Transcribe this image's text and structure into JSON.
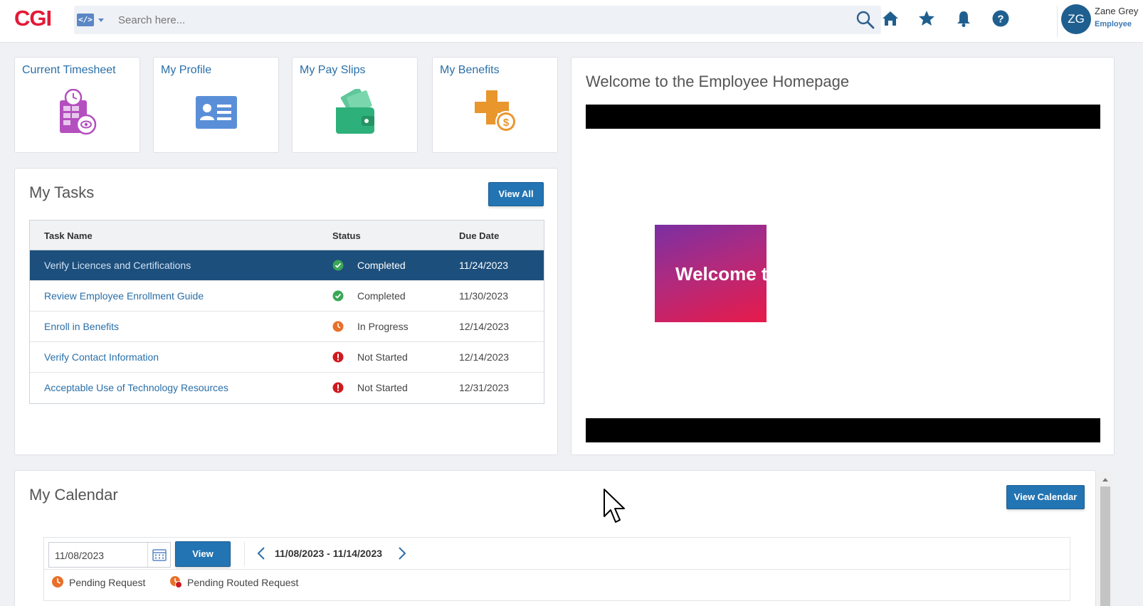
{
  "header": {
    "logo": "CGI",
    "search_placeholder": "Search here...",
    "user": {
      "initials": "ZG",
      "name": "Zane Grey",
      "role": "Employee"
    }
  },
  "tiles": [
    {
      "label": "Current Timesheet",
      "icon": "timesheet-icon"
    },
    {
      "label": "My Profile",
      "icon": "profile-card-icon"
    },
    {
      "label": "My Pay Slips",
      "icon": "wallet-icon"
    },
    {
      "label": "My Benefits",
      "icon": "benefits-icon"
    }
  ],
  "tasks": {
    "title": "My Tasks",
    "view_all": "View All",
    "columns": {
      "name": "Task Name",
      "status": "Status",
      "due": "Due Date"
    },
    "rows": [
      {
        "name": "Verify Licences and Certifications",
        "status": "Completed",
        "due": "11/24/2023",
        "status_icon": "check-icon"
      },
      {
        "name": "Review Employee Enrollment Guide",
        "status": "Completed",
        "due": "11/30/2023",
        "status_icon": "check-icon"
      },
      {
        "name": "Enroll in Benefits",
        "status": "In Progress",
        "due": "12/14/2023",
        "status_icon": "clock-icon"
      },
      {
        "name": "Verify Contact Information",
        "status": "Not Started",
        "due": "12/14/2023",
        "status_icon": "alert-icon"
      },
      {
        "name": "Acceptable Use of Technology Resources",
        "status": "Not Started",
        "due": "12/31/2023",
        "status_icon": "alert-icon"
      }
    ]
  },
  "welcome": {
    "title": "Welcome to the Employee Homepage",
    "image_text": "Welcome t"
  },
  "calendar": {
    "title": "My Calendar",
    "view_calendar": "View Calendar",
    "date_value": "11/08/2023",
    "view_label": "View",
    "range": "11/08/2023 - 11/14/2023",
    "legend": [
      {
        "label": "Pending Request"
      },
      {
        "label": "Pending Routed Request"
      }
    ]
  },
  "colors": {
    "brand": "#e31937",
    "accent": "#2374b3",
    "selected_row": "#1d4f7c",
    "completed": "#3aa757",
    "in_progress": "#e8702a",
    "not_started": "#d0191f"
  }
}
